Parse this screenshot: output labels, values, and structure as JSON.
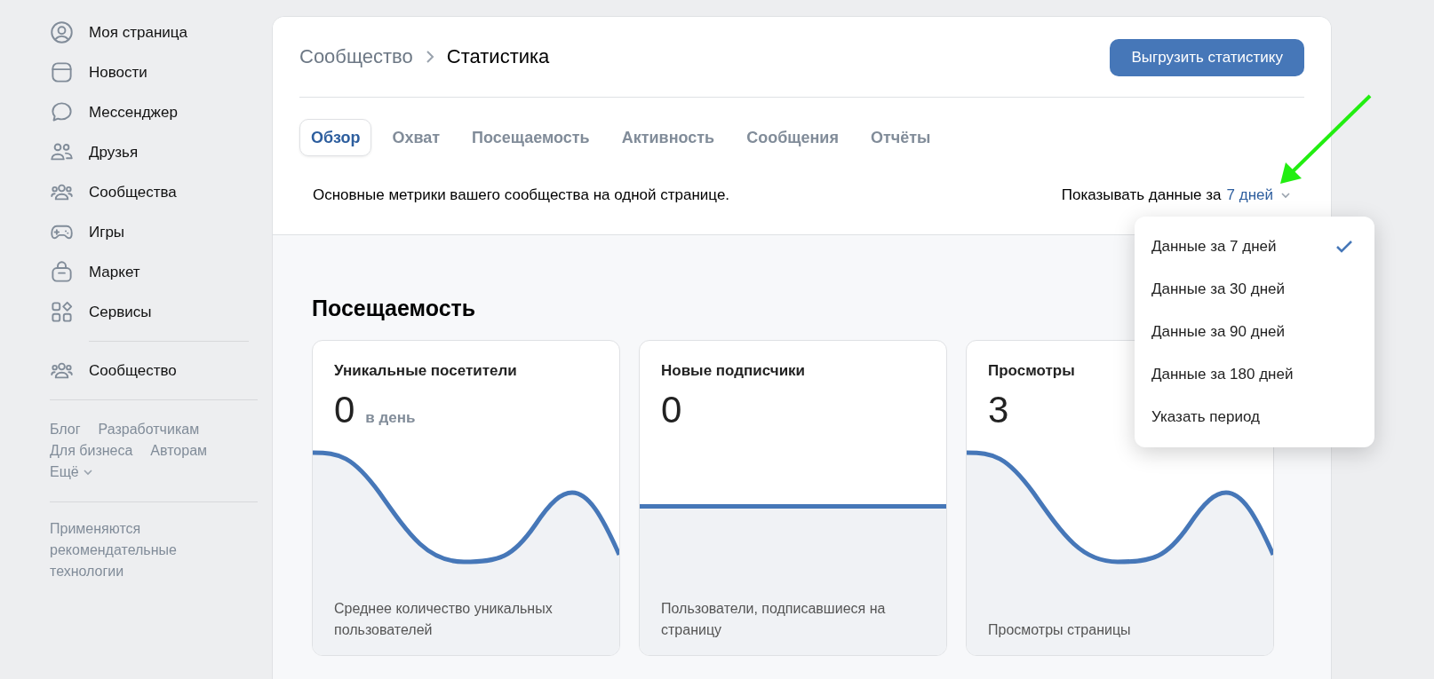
{
  "sidebar": {
    "nav": [
      {
        "label": "Моя страница",
        "kind": "profile"
      },
      {
        "label": "Новости",
        "kind": "news"
      },
      {
        "label": "Мессенджер",
        "kind": "chat"
      },
      {
        "label": "Друзья",
        "kind": "friends"
      },
      {
        "label": "Сообщества",
        "kind": "groups"
      },
      {
        "label": "Игры",
        "kind": "games"
      },
      {
        "label": "Маркет",
        "kind": "market"
      },
      {
        "label": "Сервисы",
        "kind": "services"
      }
    ],
    "community": {
      "label": "Сообщество",
      "kind": "groups"
    },
    "footer_links": [
      "Блог",
      "Разработчикам",
      "Для бизнеса",
      "Авторам"
    ],
    "more": "Ещё",
    "note": "Применяются рекомендательные технологии"
  },
  "header": {
    "breadcrumbs": [
      "Сообщество",
      "Статистика"
    ],
    "export_button": "Выгрузить статистику",
    "tabs": [
      {
        "label": "Обзор",
        "selected": true
      },
      {
        "label": "Охват",
        "selected": false
      },
      {
        "label": "Посещаемость",
        "selected": false
      },
      {
        "label": "Активность",
        "selected": false
      },
      {
        "label": "Сообщения",
        "selected": false
      },
      {
        "label": "Отчёты",
        "selected": false
      }
    ],
    "description": "Основные метрики вашего сообщества на одной странице.",
    "period": {
      "label": "Показывать данные за",
      "value": "7 дней"
    }
  },
  "dropdown": [
    {
      "label": "Данные за 7 дней",
      "selected": true
    },
    {
      "label": "Данные за 30 дней",
      "selected": false
    },
    {
      "label": "Данные за 90 дней",
      "selected": false
    },
    {
      "label": "Данные за 180 дней",
      "selected": false
    },
    {
      "label": "Указать период",
      "selected": false
    }
  ],
  "section": {
    "title": "Посещаемость",
    "cards": [
      {
        "title": "Уникальные посетители",
        "value": "0",
        "unit": "в день",
        "kind": "wave",
        "footer": "Среднее количество уникальных пользователей"
      },
      {
        "title": "Новые подписчики",
        "value": "0",
        "kind": "flat",
        "footer": "Пользователи, подписавшиеся на страницу"
      },
      {
        "title": "Просмотры",
        "value": "3",
        "kind": "wave",
        "footer": "Просмотры страницы"
      }
    ]
  }
}
